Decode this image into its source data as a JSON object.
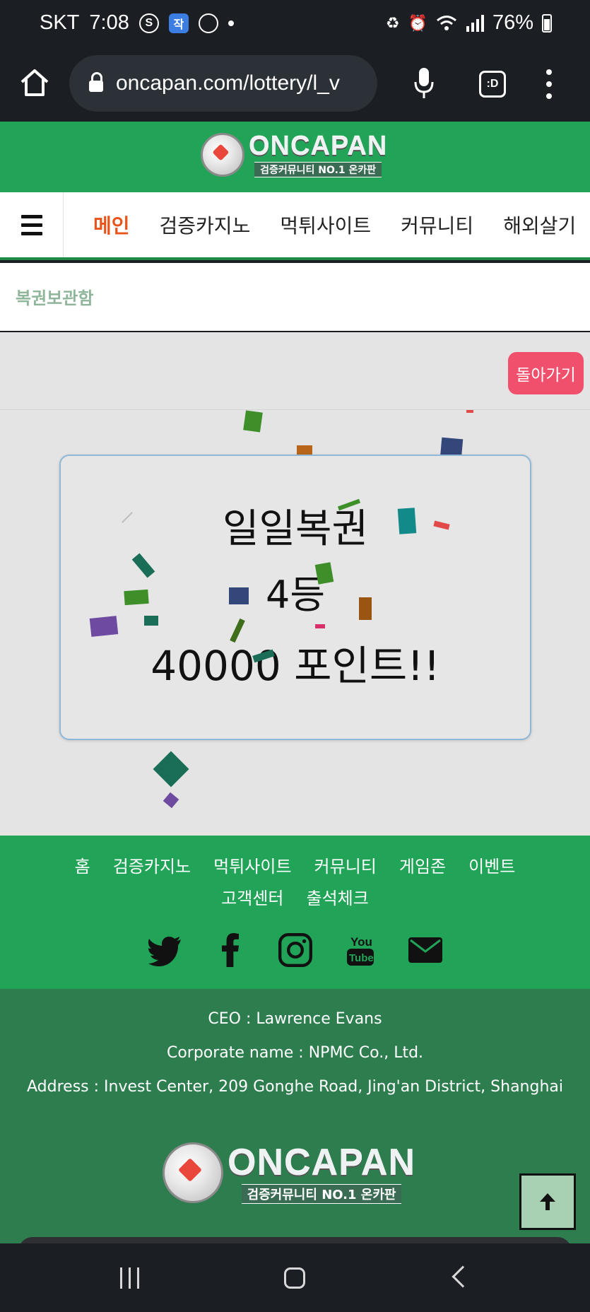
{
  "status_bar": {
    "carrier": "SKT",
    "time": "7:08",
    "battery": "76%",
    "icons": [
      "samsung-s-icon",
      "app-badge-icon",
      "messenger-icon",
      "notification-dot-icon",
      "recycle-icon",
      "alarm-icon",
      "wifi-icon",
      "signal-icon",
      "battery-icon"
    ]
  },
  "browser": {
    "url": "oncapan.com/lottery/l_v",
    "tabs_label": ":D"
  },
  "header": {
    "logo_brand": "ONCAPAN",
    "logo_tagline": "검증커뮤니티 NO.1 온카판"
  },
  "nav": {
    "items": [
      {
        "label": "메인",
        "active": true
      },
      {
        "label": "검증카지노",
        "active": false
      },
      {
        "label": "먹튀사이트",
        "active": false
      },
      {
        "label": "커뮤니티",
        "active": false
      },
      {
        "label": "해외살기",
        "active": false
      }
    ]
  },
  "page": {
    "title": "복권보관함",
    "back_button": "돌아가기"
  },
  "result": {
    "lottery_name": "일일복권",
    "rank": "4등",
    "prize": "40000 포인트!!"
  },
  "footer": {
    "links": [
      "홈",
      "검증카지노",
      "먹튀사이트",
      "커뮤니티",
      "게임존",
      "이벤트",
      "고객센터",
      "출석체크"
    ],
    "social": [
      "twitter-icon",
      "facebook-icon",
      "instagram-icon",
      "youtube-icon",
      "email-icon"
    ],
    "ceo": "CEO : Lawrence Evans",
    "corporate": "Corporate name : NPMC Co., Ltd.",
    "address": "Address : Invest Center, 209 Gonghe Road, Jing'an District, Shanghai"
  },
  "colors": {
    "brand_green": "#21a457",
    "footer_green": "#2e7d4f",
    "nav_active": "#e8541a",
    "back_button": "#f0506c",
    "card_border": "#8fb8d6"
  }
}
